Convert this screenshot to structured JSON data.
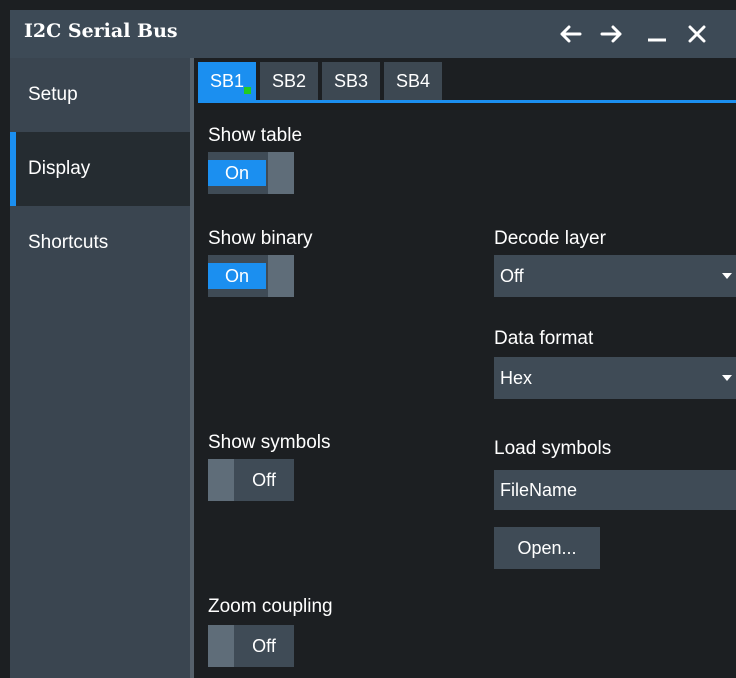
{
  "window": {
    "title": "I2C Serial Bus"
  },
  "titlebar_buttons": [
    {
      "name": "back-button",
      "icon": "arrow-left-icon"
    },
    {
      "name": "forward-button",
      "icon": "arrow-right-icon"
    },
    {
      "name": "minimize-button",
      "icon": "minimize-icon"
    },
    {
      "name": "close-button",
      "icon": "close-icon"
    }
  ],
  "sidebar": {
    "items": [
      {
        "label": "Setup",
        "active": false
      },
      {
        "label": "Display",
        "active": true
      },
      {
        "label": "Shortcuts",
        "active": false
      }
    ]
  },
  "tabs": [
    {
      "label": "SB1",
      "active": true,
      "indicator": "green"
    },
    {
      "label": "SB2",
      "active": false
    },
    {
      "label": "SB3",
      "active": false
    },
    {
      "label": "SB4",
      "active": false
    }
  ],
  "settings": {
    "show_table": {
      "label": "Show table",
      "state": "On"
    },
    "show_binary": {
      "label": "Show binary",
      "state": "On"
    },
    "show_symbols": {
      "label": "Show symbols",
      "state": "Off"
    },
    "zoom_coupling": {
      "label": "Zoom coupling",
      "state": "Off"
    },
    "decode_layer": {
      "label": "Decode layer",
      "value": "Off"
    },
    "data_format": {
      "label": "Data format",
      "value": "Hex"
    },
    "load_symbols": {
      "label": "Load symbols",
      "value": "FileName",
      "button": "Open..."
    }
  },
  "colors": {
    "accent": "#1b8ff0",
    "titlebar": "#3d4a56",
    "sidebar": "#3a4550",
    "background": "#1c1f22",
    "control": "#3f4b56",
    "indicator": "#22cc22"
  }
}
